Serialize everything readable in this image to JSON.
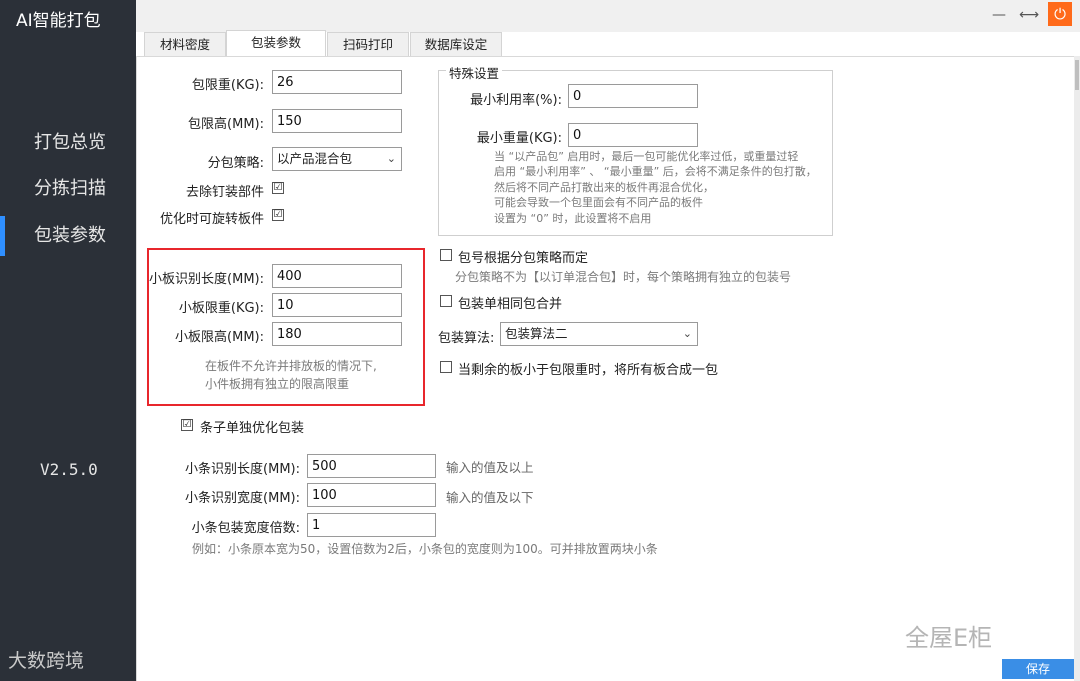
{
  "app": {
    "title": "AI智能打包",
    "version": "V2.5.0"
  },
  "sidebar": {
    "items": [
      {
        "label": "打包总览",
        "active": false
      },
      {
        "label": "分拣扫描",
        "active": false
      },
      {
        "label": "包装参数",
        "active": true
      }
    ]
  },
  "window": {
    "min": "—",
    "restore": "⟷",
    "power": "⏻"
  },
  "tabs": [
    {
      "label": "材料密度",
      "active": false
    },
    {
      "label": "包装参数",
      "active": true
    },
    {
      "label": "扫码打印",
      "active": false
    },
    {
      "label": "数据库设定",
      "active": false
    }
  ],
  "form": {
    "max_weight_label": "包限重(KG):",
    "max_weight": "26",
    "max_height_label": "包限高(MM):",
    "max_height": "150",
    "strategy_label": "分包策略:",
    "strategy": "以产品混合包",
    "remove_hardware_label": "去除钉装部件",
    "rotate_label": "优化时可旋转板件",
    "small_len_label": "小板识别长度(MM):",
    "small_len": "400",
    "small_weight_label": "小板限重(KG):",
    "small_weight": "10",
    "small_height_label": "小板限高(MM):",
    "small_height": "180",
    "small_note_1": "在板件不允许并排放板的情况下,",
    "small_note_2": "小件板拥有独立的限高限重",
    "strip_opt_label": "条子单独优化包装",
    "strip_len_label": "小条识别长度(MM):",
    "strip_len": "500",
    "strip_len_hint": "输入的值及以上",
    "strip_width_label": "小条识别宽度(MM):",
    "strip_width": "100",
    "strip_width_hint": "输入的值及以下",
    "strip_multiple_label": "小条包装宽度倍数:",
    "strip_multiple": "1",
    "strip_example": "例如：小条原本宽为50，设置倍数为2后，小条包的宽度则为100。可并排放置两块小条"
  },
  "special": {
    "title": "特殊设置",
    "min_util_label": "最小利用率(%):",
    "min_util": "0",
    "min_weight_label": "最小重量(KG):",
    "min_weight": "0",
    "note_1": "当 “以产品包” 启用时，最后一包可能优化率过低，或重量过轻",
    "note_2": "启用 “最小利用率” 、 “最小重量” 后，会将不满足条件的包打散，",
    "note_3": "然后将不同产品打散出来的板件再混合优化，",
    "note_4": "可能会导致一个包里面会有不同产品的板件",
    "note_5": "设置为 “0” 时，此设置将不启用"
  },
  "options": {
    "package_no_label": "包号根据分包策略而定",
    "package_no_note": "分包策略不为【以订单混合包】时，每个策略拥有独立的包装号",
    "merge_label": "包装单相同包合并",
    "algorithm_label": "包装算法:",
    "algorithm": "包装算法二",
    "remaining_label": "当剩余的板小于包限重时，将所有板合成一包"
  },
  "checks": {
    "remove_hardware": "☑",
    "rotate": "☑",
    "strip_opt": "☑",
    "package_no": "",
    "merge": "",
    "remaining": ""
  },
  "footer": {
    "save": "保存"
  },
  "watermarks": {
    "left": "大数跨境",
    "right": "全屋E柜"
  },
  "colors": {
    "sidebar": "#2b3038",
    "accent": "#2f8fff",
    "highlight": "#e8262c",
    "save": "#3a8ee6",
    "power": "#ff6a1a"
  }
}
